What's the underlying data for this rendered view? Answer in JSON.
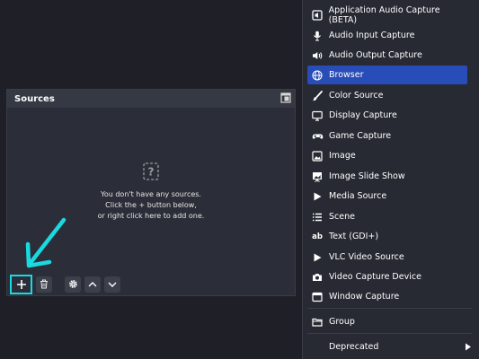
{
  "dock": {
    "title": "Sources",
    "empty_line1": "You don't have any sources.",
    "empty_line2": "Click the + button below,",
    "empty_line3": "or right click here to add one."
  },
  "toolbar": {
    "add_icon": "plus-icon",
    "remove_icon": "trash-icon",
    "properties_icon": "gear-icon",
    "up_icon": "chevron-up-icon",
    "down_icon": "chevron-down-icon"
  },
  "menu": {
    "items": [
      {
        "label": "Application Audio Capture (BETA)",
        "icon": "app-audio-icon"
      },
      {
        "label": "Audio Input Capture",
        "icon": "microphone-icon"
      },
      {
        "label": "Audio Output Capture",
        "icon": "speaker-icon"
      },
      {
        "label": "Browser",
        "icon": "globe-icon",
        "selected": true
      },
      {
        "label": "Color Source",
        "icon": "brush-icon"
      },
      {
        "label": "Display Capture",
        "icon": "monitor-icon"
      },
      {
        "label": "Game Capture",
        "icon": "gamepad-icon"
      },
      {
        "label": "Image",
        "icon": "image-icon"
      },
      {
        "label": "Image Slide Show",
        "icon": "slideshow-icon"
      },
      {
        "label": "Media Source",
        "icon": "play-icon"
      },
      {
        "label": "Scene",
        "icon": "list-icon"
      },
      {
        "label": "Text (GDI+)",
        "icon": "text-icon"
      },
      {
        "label": "VLC Video Source",
        "icon": "play-icon"
      },
      {
        "label": "Video Capture Device",
        "icon": "camera-icon"
      },
      {
        "label": "Window Capture",
        "icon": "window-icon"
      }
    ],
    "group_label": "Group",
    "deprecated_label": "Deprecated"
  },
  "colors": {
    "accent": "#284cb8",
    "annotation": "#1ad9e0",
    "panel": "#2b2e38",
    "menu_bg": "#272a33"
  }
}
